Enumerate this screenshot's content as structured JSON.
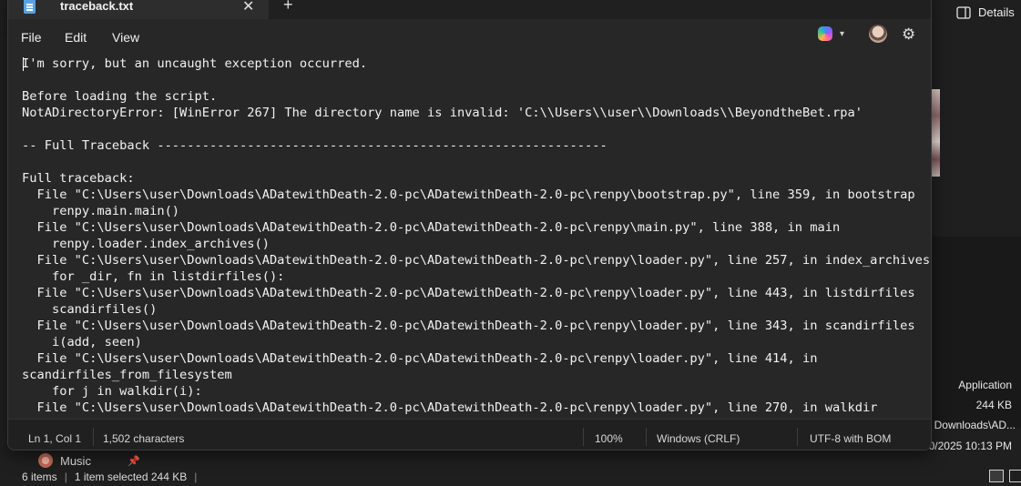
{
  "explorer": {
    "details_label": "Details",
    "file_type": "Application",
    "file_size": "244 KB",
    "file_path": "Downloads\\AD...",
    "modified": "0/2025 10:13 PM",
    "quick_item": "Music",
    "status": {
      "items_count": "6 items",
      "selected": "1 item selected  244 KB"
    }
  },
  "notepad": {
    "tab_title": "traceback.txt",
    "menu": {
      "file": "File",
      "edit": "Edit",
      "view": "View"
    },
    "content": "I'm sorry, but an uncaught exception occurred.\n\nBefore loading the script.\nNotADirectoryError: [WinError 267] The directory name is invalid: 'C:\\\\Users\\\\user\\\\Downloads\\\\BeyondtheBet.rpa'\n\n-- Full Traceback ------------------------------------------------------------\n\nFull traceback:\n  File \"C:\\Users\\user\\Downloads\\ADatewithDeath-2.0-pc\\ADatewithDeath-2.0-pc\\renpy\\bootstrap.py\", line 359, in bootstrap\n    renpy.main.main()\n  File \"C:\\Users\\user\\Downloads\\ADatewithDeath-2.0-pc\\ADatewithDeath-2.0-pc\\renpy\\main.py\", line 388, in main\n    renpy.loader.index_archives()\n  File \"C:\\Users\\user\\Downloads\\ADatewithDeath-2.0-pc\\ADatewithDeath-2.0-pc\\renpy\\loader.py\", line 257, in index_archives\n    for _dir, fn in listdirfiles():\n  File \"C:\\Users\\user\\Downloads\\ADatewithDeath-2.0-pc\\ADatewithDeath-2.0-pc\\renpy\\loader.py\", line 443, in listdirfiles\n    scandirfiles()\n  File \"C:\\Users\\user\\Downloads\\ADatewithDeath-2.0-pc\\ADatewithDeath-2.0-pc\\renpy\\loader.py\", line 343, in scandirfiles\n    i(add, seen)\n  File \"C:\\Users\\user\\Downloads\\ADatewithDeath-2.0-pc\\ADatewithDeath-2.0-pc\\renpy\\loader.py\", line 414, in\nscandirfiles_from_filesystem\n    for j in walkdir(i):\n  File \"C:\\Users\\user\\Downloads\\ADatewithDeath-2.0-pc\\ADatewithDeath-2.0-pc\\renpy\\loader.py\", line 270, in walkdir",
    "status": {
      "position": "Ln 1, Col 1",
      "characters": "1,502 characters",
      "zoom": "100%",
      "line_ending": "Windows (CRLF)",
      "encoding": "UTF-8 with BOM"
    }
  }
}
